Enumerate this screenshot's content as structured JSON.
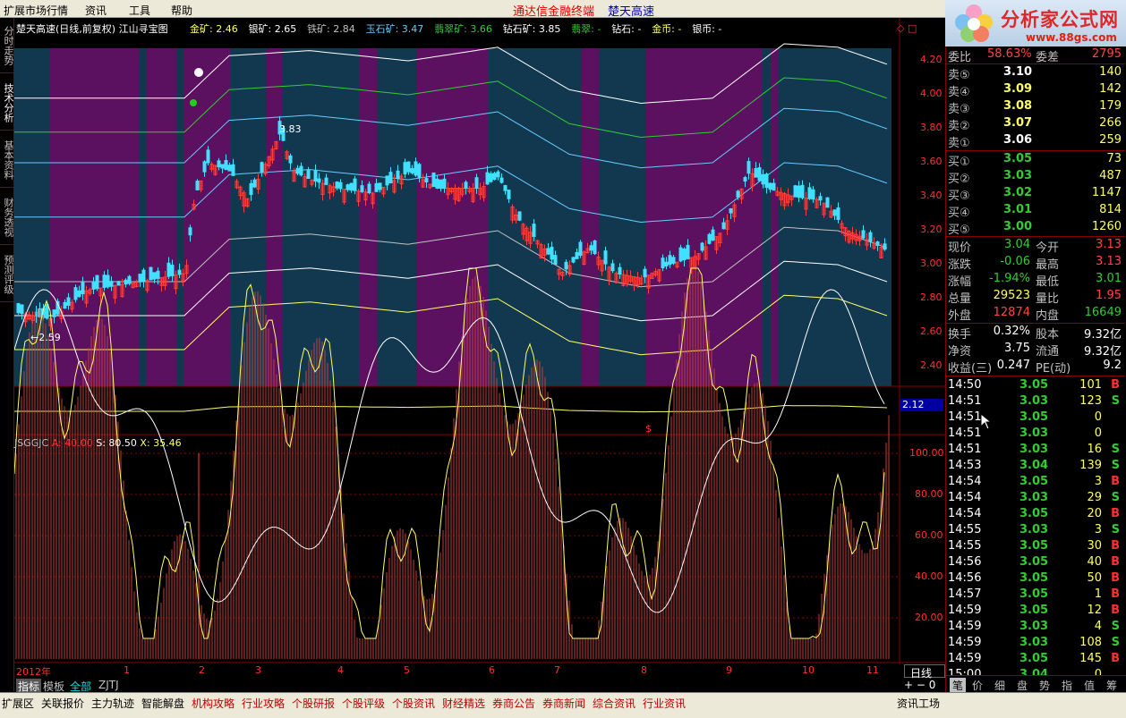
{
  "menu": {
    "items": [
      "扩展市场行情",
      "资讯",
      "工具",
      "帮助"
    ],
    "title_red": "通达信金融终端",
    "title_blue": "楚天高速"
  },
  "logo": {
    "name": "分析家公式网",
    "url": "www.88gs.com"
  },
  "side_tabs": [
    "分时走势",
    "技术分析",
    "基本资料",
    "财务透视",
    "预测评级"
  ],
  "main_chart": {
    "header": "楚天高速(日线,前复权) 江山寻宝图",
    "legend": [
      {
        "t": "金矿: 2.46",
        "c": "#ffff66"
      },
      {
        "t": "银矿: 2.65",
        "c": "#ffffff"
      },
      {
        "t": "铁矿: 2.84",
        "c": "#c0c0c0"
      },
      {
        "t": "玉石矿: 3.47",
        "c": "#66ccff"
      },
      {
        "t": "翡翠矿: 3.66",
        "c": "#33cc33"
      },
      {
        "t": "钻石矿: 3.85",
        "c": "#ffffff"
      },
      {
        "t": "翡翠: -",
        "c": "#33cc33"
      },
      {
        "t": "钻石: -",
        "c": "#ffffff"
      },
      {
        "t": "金币: -",
        "c": "#ffff66"
      },
      {
        "t": "银币: -",
        "c": "#ffffff"
      }
    ],
    "y_ticks": [
      "4.20",
      "4.00",
      "3.80",
      "3.60",
      "3.40",
      "3.20",
      "3.00",
      "2.80",
      "2.60",
      "2.40"
    ],
    "price_high_label": "3.83",
    "price_low_label": "2.59",
    "current_box": "2.12"
  },
  "chart_data": {
    "type": "candlestick",
    "title": "楚天高速(日线,前复权)",
    "y_range": [
      2.3,
      4.3
    ],
    "key_points": [
      {
        "date": "2012-01",
        "low": 2.59
      },
      {
        "date": "2012-03",
        "high": 3.83
      },
      {
        "date": "2012-11",
        "close": 3.04
      }
    ]
  },
  "indicator": {
    "name": "JSGGJC",
    "a": "A: 40.00",
    "s": "S: 80.50",
    "x": "X: 35.46",
    "y_ticks": [
      "100.00",
      "80.00",
      "60.00",
      "40.00",
      "20.00"
    ]
  },
  "x_axis": {
    "labels": [
      "2012年",
      "1",
      "2",
      "3",
      "4",
      "5",
      "6",
      "7",
      "8",
      "9",
      "10",
      "11"
    ]
  },
  "bottom_tabs": [
    "指标",
    "模板",
    "全部",
    "ZJTJ"
  ],
  "period": "日线",
  "quote": {
    "top": {
      "l1": "委比",
      "v1": "58.63%",
      "l2": "委差",
      "v2": "2795"
    },
    "sells": [
      {
        "l": "卖⑤",
        "p": "3.10",
        "v": "140"
      },
      {
        "l": "卖④",
        "p": "3.09",
        "v": "142"
      },
      {
        "l": "卖③",
        "p": "3.08",
        "v": "179"
      },
      {
        "l": "卖②",
        "p": "3.07",
        "v": "266"
      },
      {
        "l": "卖①",
        "p": "3.06",
        "v": "259"
      }
    ],
    "buys": [
      {
        "l": "买①",
        "p": "3.05",
        "v": "73"
      },
      {
        "l": "买②",
        "p": "3.03",
        "v": "487"
      },
      {
        "l": "买③",
        "p": "3.02",
        "v": "1147"
      },
      {
        "l": "买④",
        "p": "3.01",
        "v": "814"
      },
      {
        "l": "买⑤",
        "p": "3.00",
        "v": "1260"
      }
    ],
    "stats": [
      {
        "l1": "现价",
        "v1": "3.04",
        "l2": "今开",
        "v2": "3.13",
        "c1": "#33cc33",
        "c2": "#ff4444"
      },
      {
        "l1": "涨跌",
        "v1": "-0.06",
        "l2": "最高",
        "v2": "3.13",
        "c1": "#33cc33",
        "c2": "#ff4444"
      },
      {
        "l1": "涨幅",
        "v1": "-1.94%",
        "l2": "最低",
        "v2": "3.01",
        "c1": "#33cc33",
        "c2": "#33cc33"
      },
      {
        "l1": "总量",
        "v1": "29523",
        "l2": "量比",
        "v2": "1.95",
        "c1": "#ffff66",
        "c2": "#ff4444"
      },
      {
        "l1": "外盘",
        "v1": "12874",
        "l2": "内盘",
        "v2": "16649",
        "c1": "#ff4444",
        "c2": "#33cc33"
      }
    ],
    "stats2": [
      {
        "l1": "换手",
        "v1": "0.32%",
        "l2": "股本",
        "v2": "9.32亿"
      },
      {
        "l1": "净资",
        "v1": "3.75",
        "l2": "流通",
        "v2": "9.32亿"
      },
      {
        "l1": "收益(三)",
        "v1": "0.247",
        "l2": "PE(动)",
        "v2": "9.2"
      }
    ],
    "ticks": [
      {
        "t": "14:50",
        "p": "3.05",
        "v": "101",
        "s": "B"
      },
      {
        "t": "14:51",
        "p": "3.03",
        "v": "123",
        "s": "S"
      },
      {
        "t": "14:51",
        "p": "3.05",
        "v": "0",
        "s": ""
      },
      {
        "t": "14:51",
        "p": "3.03",
        "v": "0",
        "s": ""
      },
      {
        "t": "14:51",
        "p": "3.03",
        "v": "16",
        "s": "S"
      },
      {
        "t": "14:53",
        "p": "3.04",
        "v": "139",
        "s": "S"
      },
      {
        "t": "14:54",
        "p": "3.05",
        "v": "3",
        "s": "B"
      },
      {
        "t": "14:54",
        "p": "3.03",
        "v": "29",
        "s": "S"
      },
      {
        "t": "14:54",
        "p": "3.05",
        "v": "20",
        "s": "B"
      },
      {
        "t": "14:55",
        "p": "3.03",
        "v": "3",
        "s": "S"
      },
      {
        "t": "14:55",
        "p": "3.05",
        "v": "30",
        "s": "B"
      },
      {
        "t": "14:56",
        "p": "3.05",
        "v": "40",
        "s": "B"
      },
      {
        "t": "14:56",
        "p": "3.05",
        "v": "50",
        "s": "B"
      },
      {
        "t": "14:57",
        "p": "3.05",
        "v": "1",
        "s": "B"
      },
      {
        "t": "14:59",
        "p": "3.05",
        "v": "12",
        "s": "B"
      },
      {
        "t": "14:59",
        "p": "3.03",
        "v": "4",
        "s": "S"
      },
      {
        "t": "14:59",
        "p": "3.03",
        "v": "108",
        "s": "S"
      },
      {
        "t": "14:59",
        "p": "3.05",
        "v": "145",
        "s": "B"
      },
      {
        "t": "15:00",
        "p": "3.04",
        "v": "0",
        "s": ""
      }
    ]
  },
  "right_tabs": [
    "笔",
    "价",
    "细",
    "盘",
    "势",
    "指",
    "值",
    "筹"
  ],
  "bottom_bar": [
    "扩展区",
    "关联报价",
    "主力轨迹",
    "智能解盘",
    "机构攻略",
    "行业攻略",
    "个股研报",
    "个股评级",
    "个股资讯",
    "财经精选",
    "券商公告",
    "券商新闻",
    "综合资讯",
    "行业资讯"
  ],
  "bottom_right": "资讯工场"
}
